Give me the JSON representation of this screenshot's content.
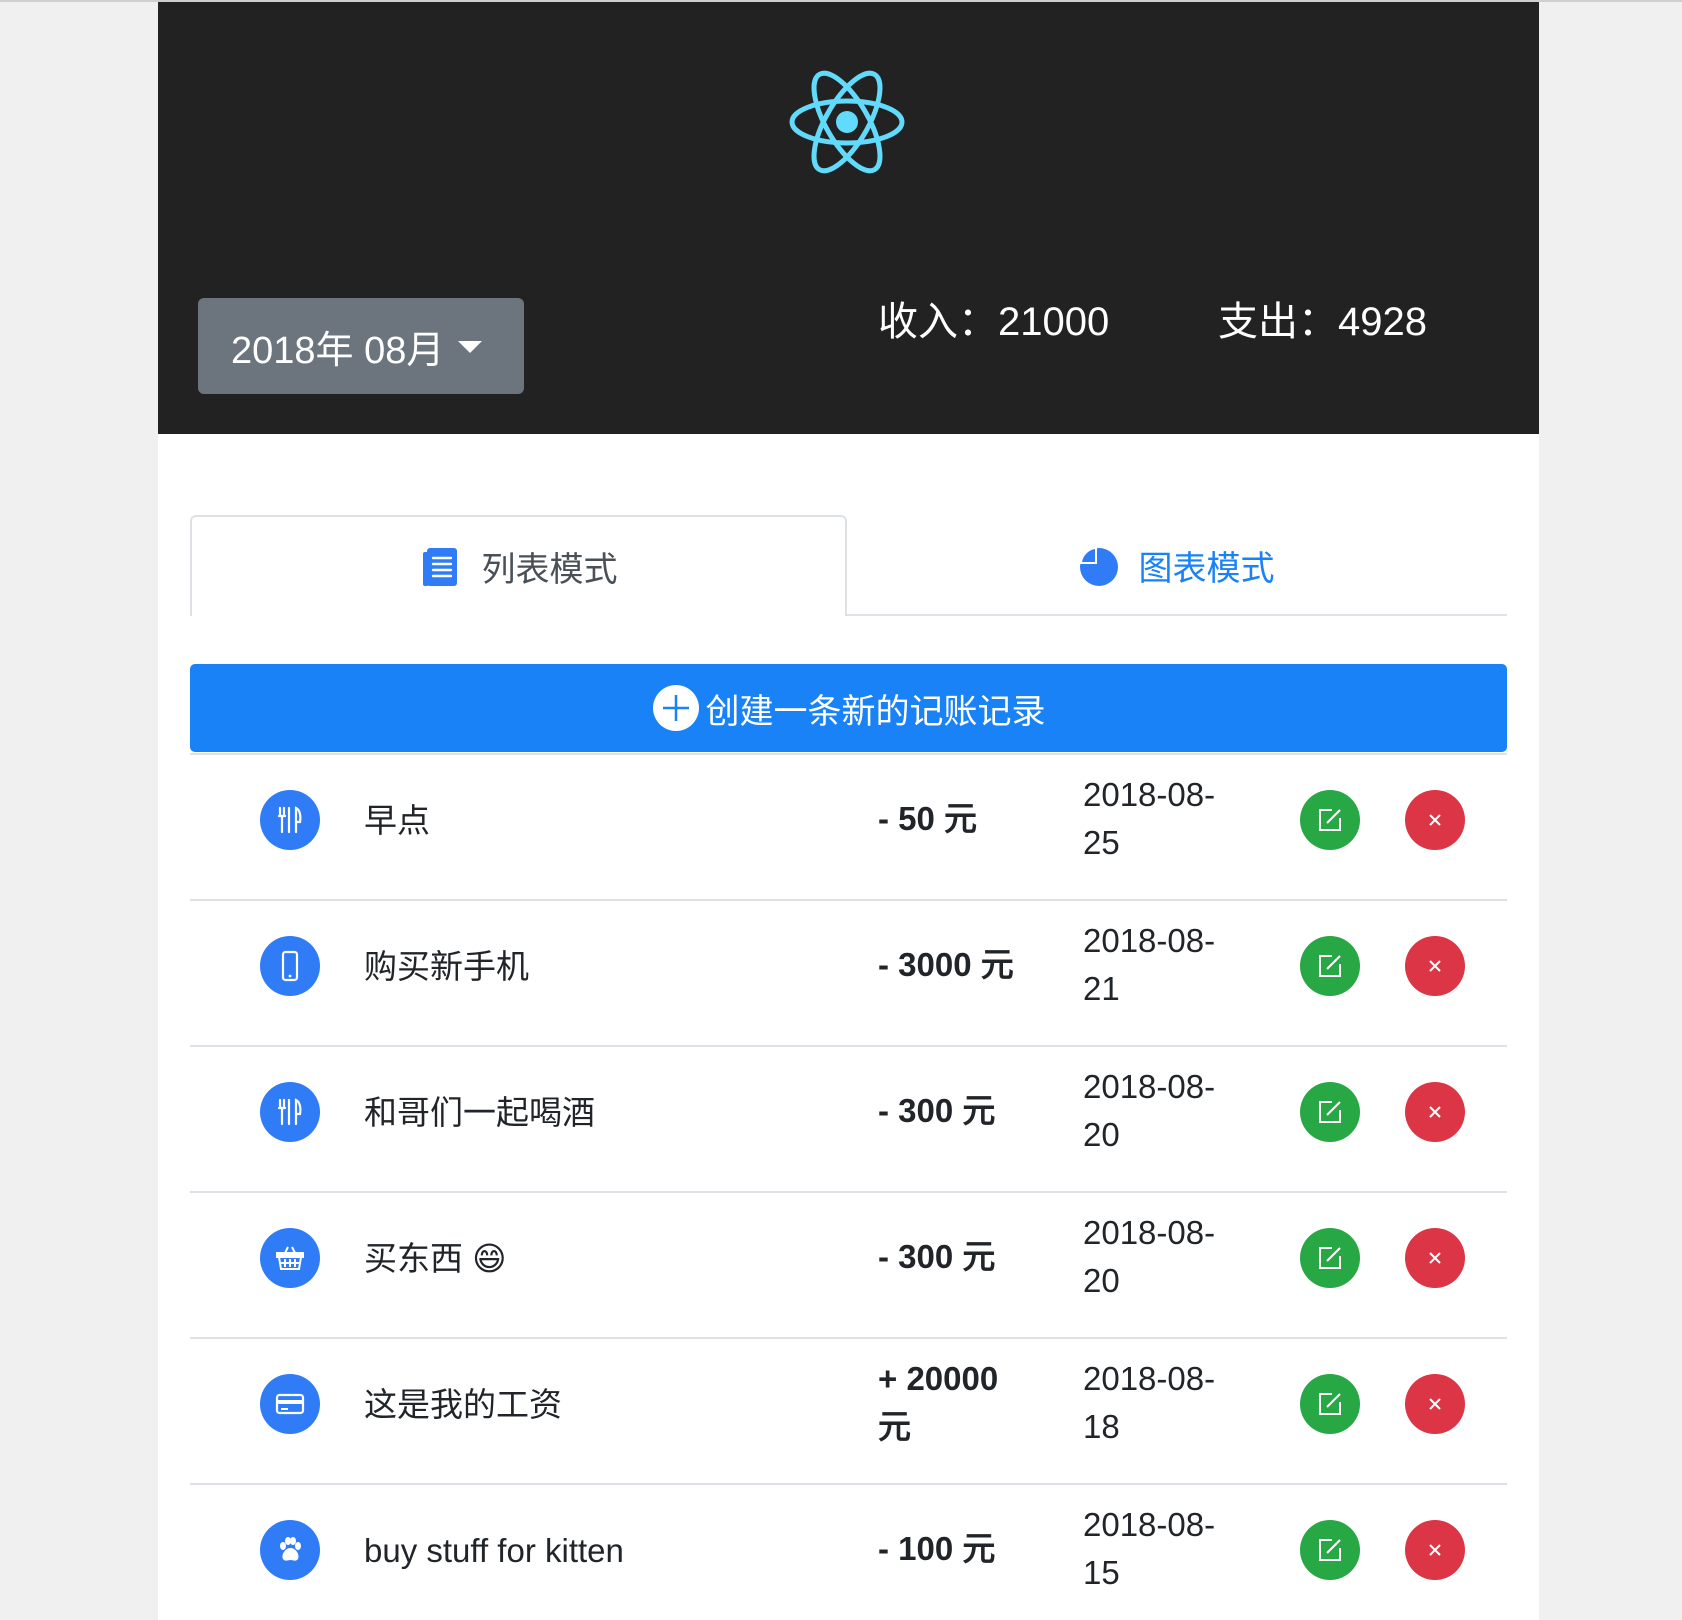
{
  "header": {
    "logo_icon": "react-atom-logo",
    "logo_color": "#61dafb",
    "month_selector": "2018年 08月",
    "income_label": "收入：",
    "income_value": "21000",
    "expense_label": "支出：",
    "expense_value": "4928"
  },
  "tabs": [
    {
      "label": "列表模式",
      "icon": "list-icon",
      "active": true
    },
    {
      "label": "图表模式",
      "icon": "pie-chart-icon",
      "active": false
    }
  ],
  "create_button": {
    "label": "创建一条新的记账记录",
    "icon": "plus-circle-icon"
  },
  "records": [
    {
      "icon": "restaurant-icon",
      "title": "早点",
      "amount": "- 50 元",
      "date": "2018-08-25"
    },
    {
      "icon": "phone-icon",
      "title": "购买新手机",
      "amount": "- 3000 元",
      "date": "2018-08-21"
    },
    {
      "icon": "restaurant-icon",
      "title": "和哥们一起喝酒",
      "amount": "- 300 元",
      "date": "2018-08-20"
    },
    {
      "icon": "basket-icon",
      "title": "买东西 😄",
      "amount": "- 300 元",
      "date": "2018-08-20"
    },
    {
      "icon": "card-icon",
      "title": "这是我的工资",
      "amount": "+ 20000 元",
      "date": "2018-08-18"
    },
    {
      "icon": "paw-icon",
      "title": "buy stuff for kitten",
      "amount": "- 100 元",
      "date": "2018-08-15"
    }
  ],
  "colors": {
    "header_bg": "#222222",
    "primary": "#1a82f7",
    "category_icon_bg": "#2f7cf6",
    "edit": "#28a745",
    "delete": "#dc3545",
    "month_button": "#6c757d"
  }
}
